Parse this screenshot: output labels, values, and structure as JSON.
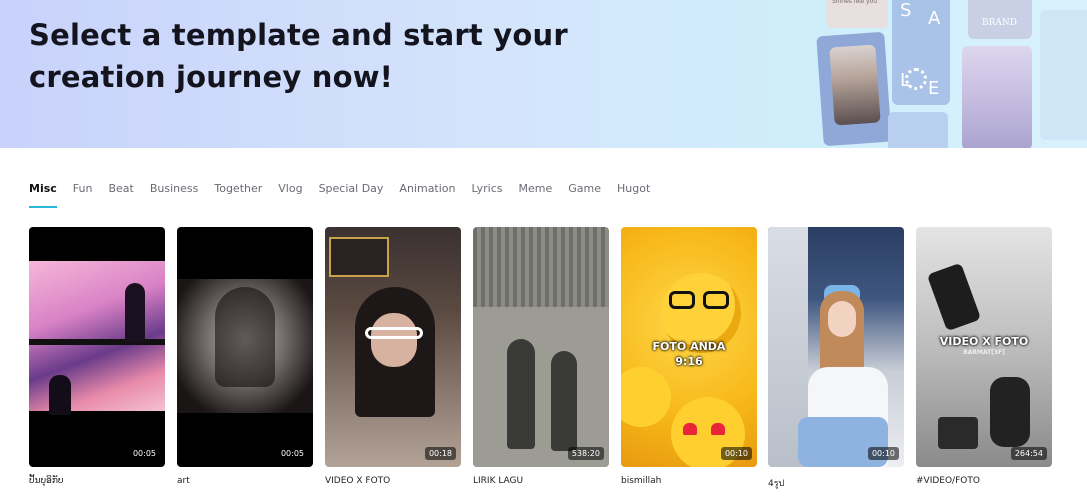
{
  "hero": {
    "title": "Select a template and start your creation journey now!",
    "decor_letters": [
      "S",
      "A",
      "L",
      "E"
    ],
    "decor_brand": "BRAND",
    "decor_caption": "Shines like you"
  },
  "tabs": [
    {
      "label": "Misc",
      "active": true
    },
    {
      "label": "Fun"
    },
    {
      "label": "Beat"
    },
    {
      "label": "Business"
    },
    {
      "label": "Together"
    },
    {
      "label": "Vlog"
    },
    {
      "label": "Special Day"
    },
    {
      "label": "Animation"
    },
    {
      "label": "Lyrics"
    },
    {
      "label": "Meme"
    },
    {
      "label": "Game"
    },
    {
      "label": "Hugot"
    }
  ],
  "templates": [
    {
      "title": "ປັ້ນບຸອິກັບ",
      "duration": "00:05"
    },
    {
      "title": "art",
      "duration": "00:05"
    },
    {
      "title": "VIDEO X FOTO",
      "duration": "00:18"
    },
    {
      "title": "LIRIK LAGU",
      "duration": "538:20"
    },
    {
      "title": "bismillah",
      "duration": "00:10",
      "overlay": "FOTO ANDA\n9:16"
    },
    {
      "title": "4รูป",
      "duration": "00:10"
    },
    {
      "title": "#VIDEO/FOTO",
      "duration": "264:54",
      "overlay": "VIDEO X FOTO",
      "overlay_sub": "BARMAT[3F]"
    }
  ],
  "colors": {
    "accent": "#2bb7d6",
    "text": "#14141f",
    "tab_inactive": "#6b6b75"
  }
}
